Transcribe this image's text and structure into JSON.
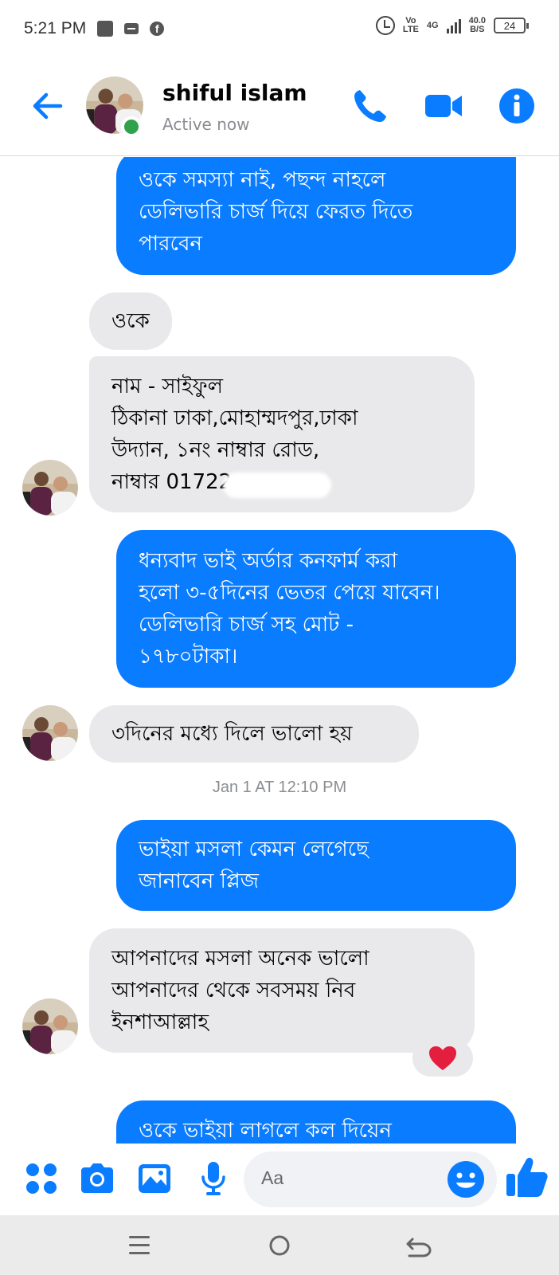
{
  "status_bar": {
    "time": "5:21 PM",
    "network_top": "Vo",
    "network_bottom": "LTE",
    "gen": "4G",
    "speed_top": "40.0",
    "speed_bottom": "B/S",
    "battery": "24"
  },
  "header": {
    "contact_name": "shiful islam",
    "status": "Active now",
    "icons": [
      "back-arrow-icon",
      "phone-icon",
      "video-camera-icon",
      "info-icon"
    ],
    "accent_color": "#0a7cff",
    "online_color": "#31a24c"
  },
  "messages": [
    {
      "direction": "outgoing",
      "text": "ওকে সমস্যা নাই, পছন্দ নাহলে\nডেলিভারি চার্জ দিয়ে ফেরত দিতে\nপারবেন"
    },
    {
      "direction": "incoming",
      "text": "ওকে"
    },
    {
      "direction": "incoming",
      "text": "নাম - সাইফুল\nঠিকানা ঢাকা,মোহাম্মদপুর,ঢাকা\nউদ্যান, ১নং নাম্বার রোড,\nনাম্বার 01722"
    },
    {
      "direction": "outgoing",
      "text": "ধন্যবাদ ভাই অর্ডার কনফার্ম করা\nহলো ৩-৫দিনের ভেতর পেয়ে যাবেন।\nডেলিভারি চার্জ সহ মোট -\n১৭৮০টাকা।"
    },
    {
      "direction": "incoming",
      "text": "৩দিনের মধ্যে দিলে ভালো হয়"
    },
    {
      "direction": "outgoing",
      "text": "ভাইয়া মসলা কেমন লেগেছে\nজানাবেন প্লিজ"
    },
    {
      "direction": "incoming",
      "text": "আপনাদের মসলা অনেক ভালো\nআপনাদের থেকে সবসময় নিব\nইনশাআল্লাহ",
      "reaction": "heart"
    },
    {
      "direction": "outgoing",
      "text": "ওকে ভাইয়া লাগলে কল দিয়েন"
    }
  ],
  "timestamp": "Jan 1 AT 12:10 PM",
  "composer": {
    "placeholder": "Aa",
    "icons": [
      "apps-icon",
      "camera-icon",
      "gallery-icon",
      "microphone-icon",
      "emoji-icon",
      "thumbs-up-icon"
    ]
  },
  "nav_bar": {
    "icons": [
      "menu-icon",
      "home-icon",
      "back-icon"
    ]
  }
}
